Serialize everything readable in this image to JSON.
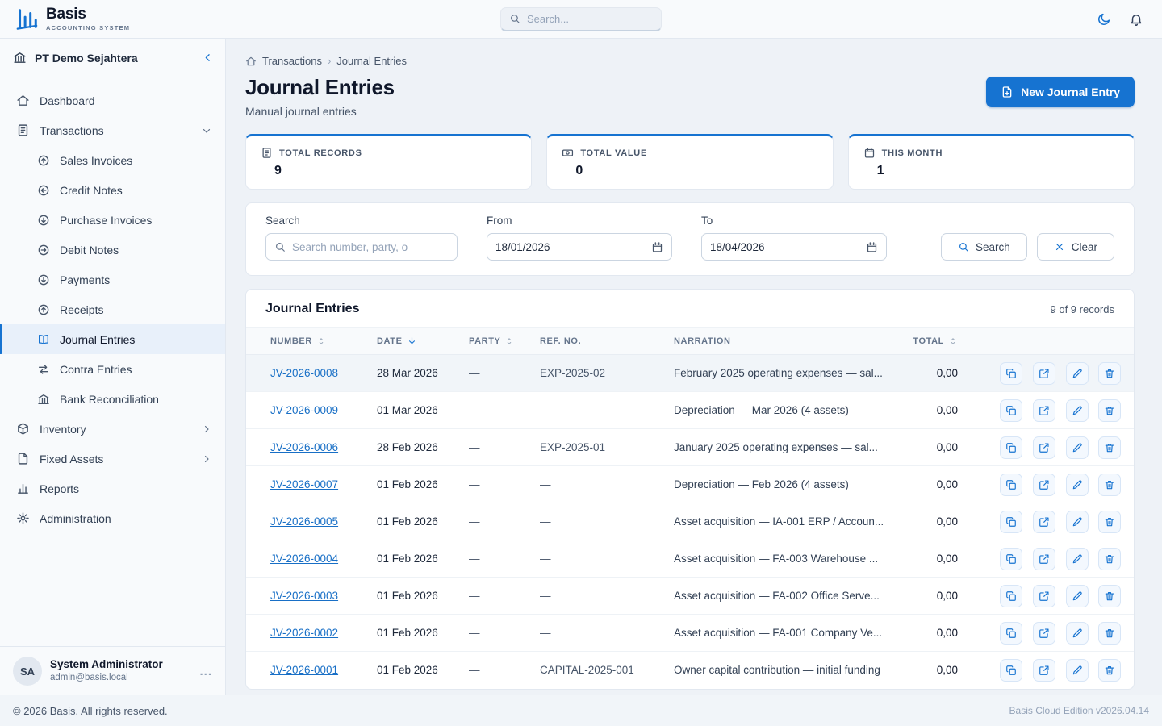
{
  "topbar": {
    "brand": "Basis",
    "brand_sub": "ACCOUNTING SYSTEM",
    "search_placeholder": "Search..."
  },
  "sidebar": {
    "company": "PT Demo Sejahtera",
    "items": {
      "dashboard": "Dashboard",
      "transactions": "Transactions",
      "sales_invoices": "Sales Invoices",
      "credit_notes": "Credit Notes",
      "purchase_invoices": "Purchase Invoices",
      "debit_notes": "Debit Notes",
      "payments": "Payments",
      "receipts": "Receipts",
      "journal_entries": "Journal Entries",
      "contra_entries": "Contra Entries",
      "bank_reconciliation": "Bank Reconciliation",
      "inventory": "Inventory",
      "fixed_assets": "Fixed Assets",
      "reports": "Reports",
      "administration": "Administration"
    },
    "user": {
      "initials": "SA",
      "name": "System Administrator",
      "email": "admin@basis.local",
      "menu": "..."
    }
  },
  "breadcrumb": {
    "section": "Transactions",
    "separator": "›",
    "current": "Journal Entries"
  },
  "page": {
    "title": "Journal Entries",
    "subtitle": "Manual journal entries",
    "new_button": "New Journal Entry"
  },
  "stats": {
    "records": {
      "label": "TOTAL RECORDS",
      "value": "9"
    },
    "value": {
      "label": "TOTAL VALUE",
      "value": "0"
    },
    "month": {
      "label": "THIS MONTH",
      "value": "1"
    }
  },
  "filters": {
    "search_label": "Search",
    "search_placeholder": "Search number, party, o",
    "from_label": "From",
    "from_value": "18/01/2026",
    "to_label": "To",
    "to_value": "18/04/2026",
    "search_button": "Search",
    "clear_button": "Clear"
  },
  "table": {
    "title": "Journal Entries",
    "records_info": "9 of 9 records",
    "headers": {
      "number": "NUMBER",
      "date": "DATE",
      "party": "PARTY",
      "ref": "REF. NO.",
      "narration": "NARRATION",
      "total": "TOTAL"
    },
    "rows": [
      {
        "number": "JV-2026-0008",
        "date": "28 Mar 2026",
        "party": "—",
        "ref": "EXP-2025-02",
        "narration": "February 2025 operating expenses — sal...",
        "total": "0,00"
      },
      {
        "number": "JV-2026-0009",
        "date": "01 Mar 2026",
        "party": "—",
        "ref": "—",
        "narration": "Depreciation — Mar 2026 (4 assets)",
        "total": "0,00"
      },
      {
        "number": "JV-2026-0006",
        "date": "28 Feb 2026",
        "party": "—",
        "ref": "EXP-2025-01",
        "narration": "January 2025 operating expenses — sal...",
        "total": "0,00"
      },
      {
        "number": "JV-2026-0007",
        "date": "01 Feb 2026",
        "party": "—",
        "ref": "—",
        "narration": "Depreciation — Feb 2026 (4 assets)",
        "total": "0,00"
      },
      {
        "number": "JV-2026-0005",
        "date": "01 Feb 2026",
        "party": "—",
        "ref": "—",
        "narration": "Asset acquisition — IA-001 ERP / Accoun...",
        "total": "0,00"
      },
      {
        "number": "JV-2026-0004",
        "date": "01 Feb 2026",
        "party": "—",
        "ref": "—",
        "narration": "Asset acquisition — FA-003 Warehouse ...",
        "total": "0,00"
      },
      {
        "number": "JV-2026-0003",
        "date": "01 Feb 2026",
        "party": "—",
        "ref": "—",
        "narration": "Asset acquisition — FA-002 Office Serve...",
        "total": "0,00"
      },
      {
        "number": "JV-2026-0002",
        "date": "01 Feb 2026",
        "party": "—",
        "ref": "—",
        "narration": "Asset acquisition — FA-001 Company Ve...",
        "total": "0,00"
      },
      {
        "number": "JV-2026-0001",
        "date": "01 Feb 2026",
        "party": "—",
        "ref": "CAPITAL-2025-001",
        "narration": "Owner capital contribution — initial funding",
        "total": "0,00"
      }
    ]
  },
  "footer": {
    "copyright": "© 2026 Basis. All rights reserved.",
    "edition": "Basis Cloud Edition v2026.04.14"
  },
  "colors": {
    "primary": "#1673d1",
    "link": "#186fc6"
  },
  "icons": {
    "topbar": [
      "search-icon",
      "moon-icon",
      "bell-icon"
    ],
    "row_actions": [
      "duplicate-icon",
      "external-link-icon",
      "edit-pencil-icon",
      "delete-trash-icon"
    ]
  }
}
